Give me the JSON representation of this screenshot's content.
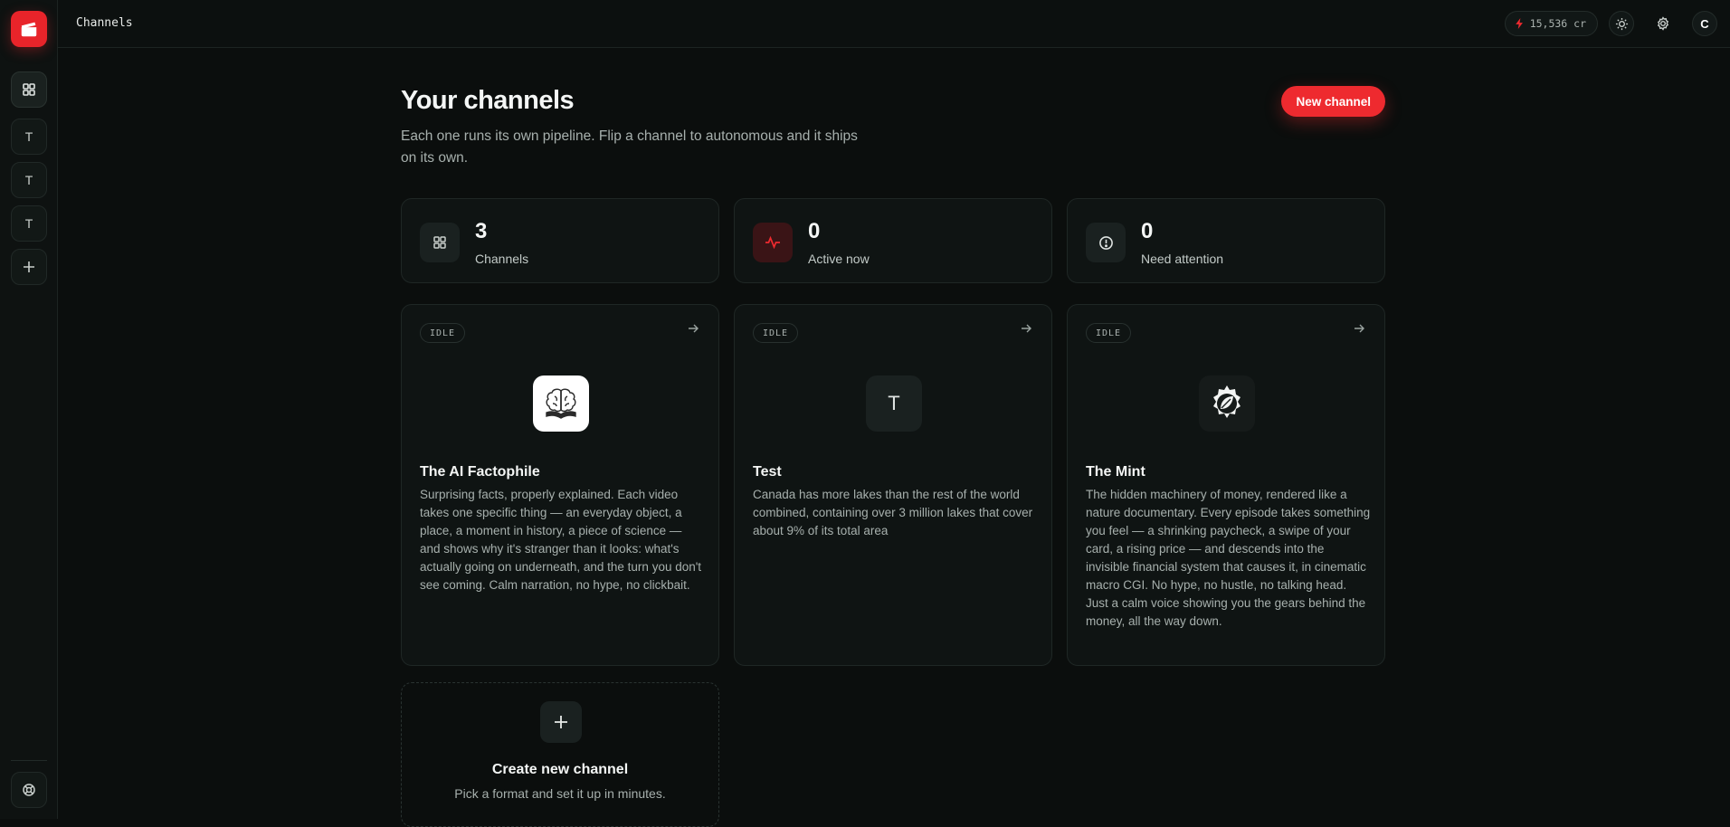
{
  "topbar": {
    "title": "Channels",
    "credits": "15,536 cr",
    "avatar_initial": "C"
  },
  "sidebar": {
    "items": [
      {
        "label": "T"
      },
      {
        "label": "T"
      },
      {
        "label": "T"
      }
    ]
  },
  "header": {
    "title": "Your channels",
    "subtitle": "Each one runs its own pipeline. Flip a channel to autonomous and it ships on its own.",
    "new_button": "New channel"
  },
  "stats": [
    {
      "value": "3",
      "label": "Channels",
      "icon": "grid-icon"
    },
    {
      "value": "0",
      "label": "Active now",
      "icon": "activity-icon"
    },
    {
      "value": "0",
      "label": "Need attention",
      "icon": "alert-circle-icon"
    }
  ],
  "channels": [
    {
      "status": "IDLE",
      "title": "The AI Factophile",
      "description": "Surprising facts, properly explained. Each video takes one specific thing — an everyday object, a place, a moment in history, a piece of science — and shows why it's stranger than it looks: what's actually going on underneath, and the turn you don't see coming. Calm narration, no hype, no clickbait.",
      "thumb": "brain-book-icon"
    },
    {
      "status": "IDLE",
      "title": "Test",
      "description": "Canada has more lakes than the rest of the world combined, containing over 3 million lakes that cover about 9% of its total area",
      "thumb_letter": "T"
    },
    {
      "status": "IDLE",
      "title": "The Mint",
      "description": "The hidden machinery of money, rendered like a nature documentary. Every episode takes something you feel — a shrinking paycheck, a swipe of your card, a rising price — and descends into the invisible financial system that causes it, in cinematic macro CGI. No hype, no hustle, no talking head. Just a calm voice showing you the gears behind the money, all the way down.",
      "thumb": "gear-leaf-icon"
    }
  ],
  "create": {
    "title": "Create new channel",
    "subtitle": "Pick a format and set it up in minutes."
  },
  "colors": {
    "accent": "#ee2a2f",
    "background": "#0b0e0d",
    "card": "#0f1413"
  }
}
